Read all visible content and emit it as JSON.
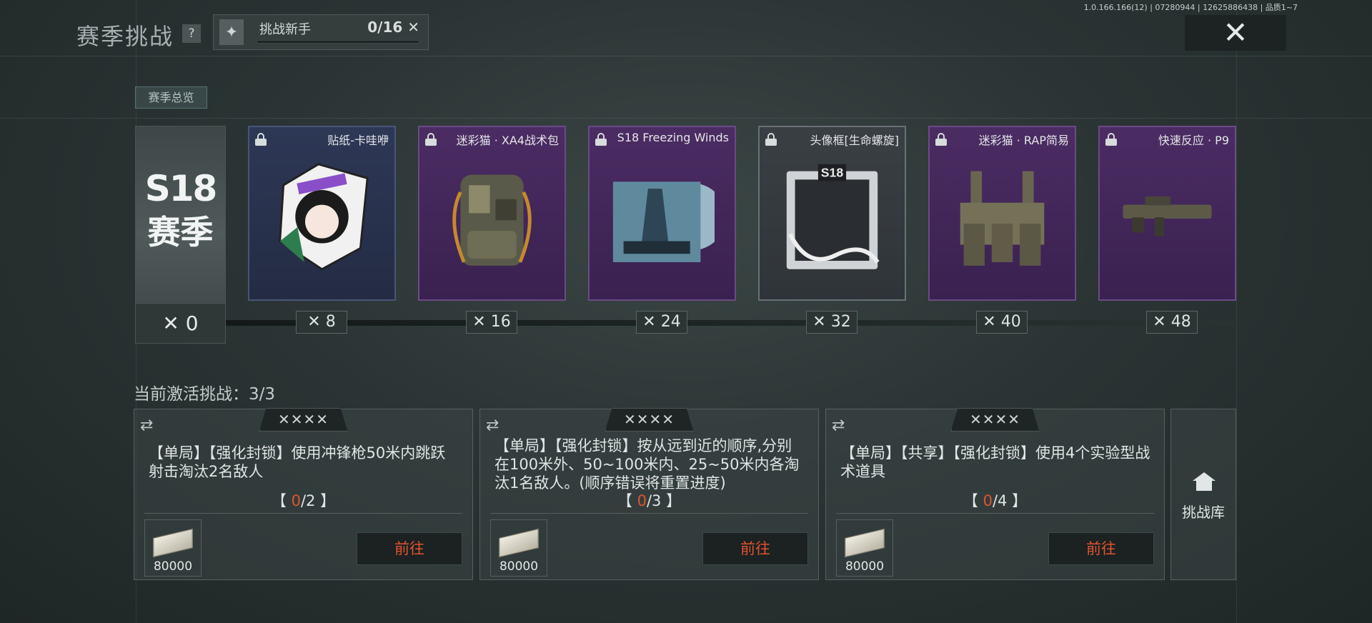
{
  "header": {
    "title": "赛季挑战",
    "help_label": "?",
    "rank": {
      "name": "挑战新手",
      "count": "0/16 ✕",
      "progress": 0
    },
    "version": "1.0.166.166(12) | 07280944 | 12625886438 | 品质1~7",
    "close_label": "✕"
  },
  "overview_tab": "赛季总览",
  "season_card": {
    "code": "S18",
    "word": "赛季",
    "start": "✕ 0"
  },
  "rewards": [
    {
      "name": "贴纸-卡哇咿",
      "tick": "✕ 8",
      "rarity": "blue",
      "icon": "sticker-icon"
    },
    {
      "name": "迷彩猫 · XA4战术包",
      "tick": "✕ 16",
      "rarity": "purple",
      "icon": "backpack-icon"
    },
    {
      "name": "S18 Freezing Winds",
      "tick": "✕ 24",
      "rarity": "purple",
      "icon": "album-icon"
    },
    {
      "name": "头像框[生命螺旋]",
      "tick": "✕ 32",
      "rarity": "gray",
      "icon": "avatar-frame-icon"
    },
    {
      "name": "迷彩猫 · RAP简易",
      "tick": "✕ 40",
      "rarity": "purple",
      "icon": "vest-icon"
    },
    {
      "name": "快速反应 · P9",
      "tick": "✕ 48",
      "rarity": "purple",
      "icon": "gun-icon"
    }
  ],
  "active_challenges_title": "当前激活挑战：3/3",
  "challenges": [
    {
      "stars": "✕✕✕✕",
      "desc": "【单局】【强化封锁】使用冲锋枪50米内跳跃射击淘汰2名敌人",
      "progress_current": "0",
      "progress_total": "/2",
      "reward_amount": "80000",
      "go_label": "前往"
    },
    {
      "stars": "✕✕✕✕",
      "desc": "【单局】【强化封锁】按从远到近的顺序,分别在100米外、50~100米内、25~50米内各淘汰1名敌人。(顺序错误将重置进度)",
      "progress_current": "0",
      "progress_total": "/3",
      "reward_amount": "80000",
      "go_label": "前往"
    },
    {
      "stars": "✕✕✕✕",
      "desc": "【单局】【共享】【强化封锁】使用4个实验型战术道具",
      "progress_current": "0",
      "progress_total": "/4",
      "reward_amount": "80000",
      "go_label": "前往"
    }
  ],
  "library_label": "挑战库",
  "colors": {
    "accent": "#e0542e",
    "purple": "#4b2c63",
    "blue": "#2d3856"
  }
}
